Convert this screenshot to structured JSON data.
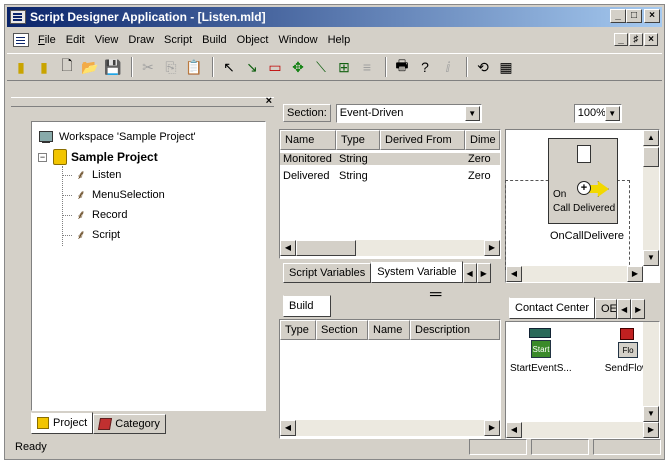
{
  "window": {
    "title": "Script Designer Application - [Listen.mld]",
    "min": "_",
    "max": "□",
    "close": "×"
  },
  "menu": {
    "items": [
      {
        "ul": "F",
        "rest": "ile"
      },
      {
        "ul": "",
        "rest": "Edit"
      },
      {
        "ul": "",
        "rest": "View"
      },
      {
        "ul": "",
        "rest": "Draw"
      },
      {
        "ul": "",
        "rest": "Script"
      },
      {
        "ul": "",
        "rest": "Build"
      },
      {
        "ul": "",
        "rest": "Object"
      },
      {
        "ul": "",
        "rest": "Window"
      },
      {
        "ul": "",
        "rest": "Help"
      }
    ],
    "mdi_min": "_",
    "mdi_restore": "♯",
    "mdi_close": "×"
  },
  "toolbar": {
    "icons": [
      "new-script-icon",
      "open-project-icon",
      "new-file-icon",
      "open-folder-icon",
      "save-icon",
      "cut-icon",
      "copy-icon",
      "paste-icon",
      "pointer-icon",
      "connector-icon",
      "rectangle-icon",
      "move-icon",
      "line-icon",
      "tree-icon",
      "align-icon",
      "print-icon",
      "help-icon",
      "variable-icon",
      "rotate-icon",
      "grid-icon"
    ],
    "glyphs": [
      "▮",
      "▮",
      "🗋",
      "📂",
      "💾",
      "✂",
      "⎘",
      "📋",
      "↖",
      "↘",
      "▭",
      "✥",
      "⟍",
      "⊞",
      "≡",
      "🖶",
      "?",
      "ⅈ",
      "⟲",
      "▦"
    ]
  },
  "left_pane": {
    "close": "×",
    "workspace": "Workspace 'Sample Project'",
    "project": "Sample Project",
    "expander": "−",
    "scripts": [
      "Listen",
      "MenuSelection",
      "Record",
      "Script"
    ],
    "tabs": [
      "Project",
      "Category"
    ]
  },
  "section": {
    "label": "Section:",
    "value": "Event-Driven",
    "zoom": "100%"
  },
  "variables": {
    "columns": [
      "Name",
      "Type",
      "Derived From",
      "Dime"
    ],
    "rows": [
      [
        "Monitored",
        "String",
        "",
        "Zero"
      ],
      [
        "Delivered",
        "String",
        "",
        "Zero"
      ]
    ],
    "tabs": [
      "Script Variables",
      "System Variable"
    ]
  },
  "canvas": {
    "node_label_1": "On",
    "node_label_2": "Call Delivered",
    "node_caption": "OnCallDelivere"
  },
  "build": {
    "tab": "Build",
    "columns": [
      "Type",
      "Section",
      "Name",
      "Description"
    ]
  },
  "palette": {
    "tabs": [
      "Contact Center",
      "OE"
    ],
    "tools": [
      {
        "icon": "start-icon",
        "badge": "Start",
        "caption": "StartEventS..."
      },
      {
        "icon": "send-flow-icon",
        "badge": "Flo",
        "caption": "SendFlow"
      }
    ]
  },
  "status": {
    "text": "Ready"
  }
}
